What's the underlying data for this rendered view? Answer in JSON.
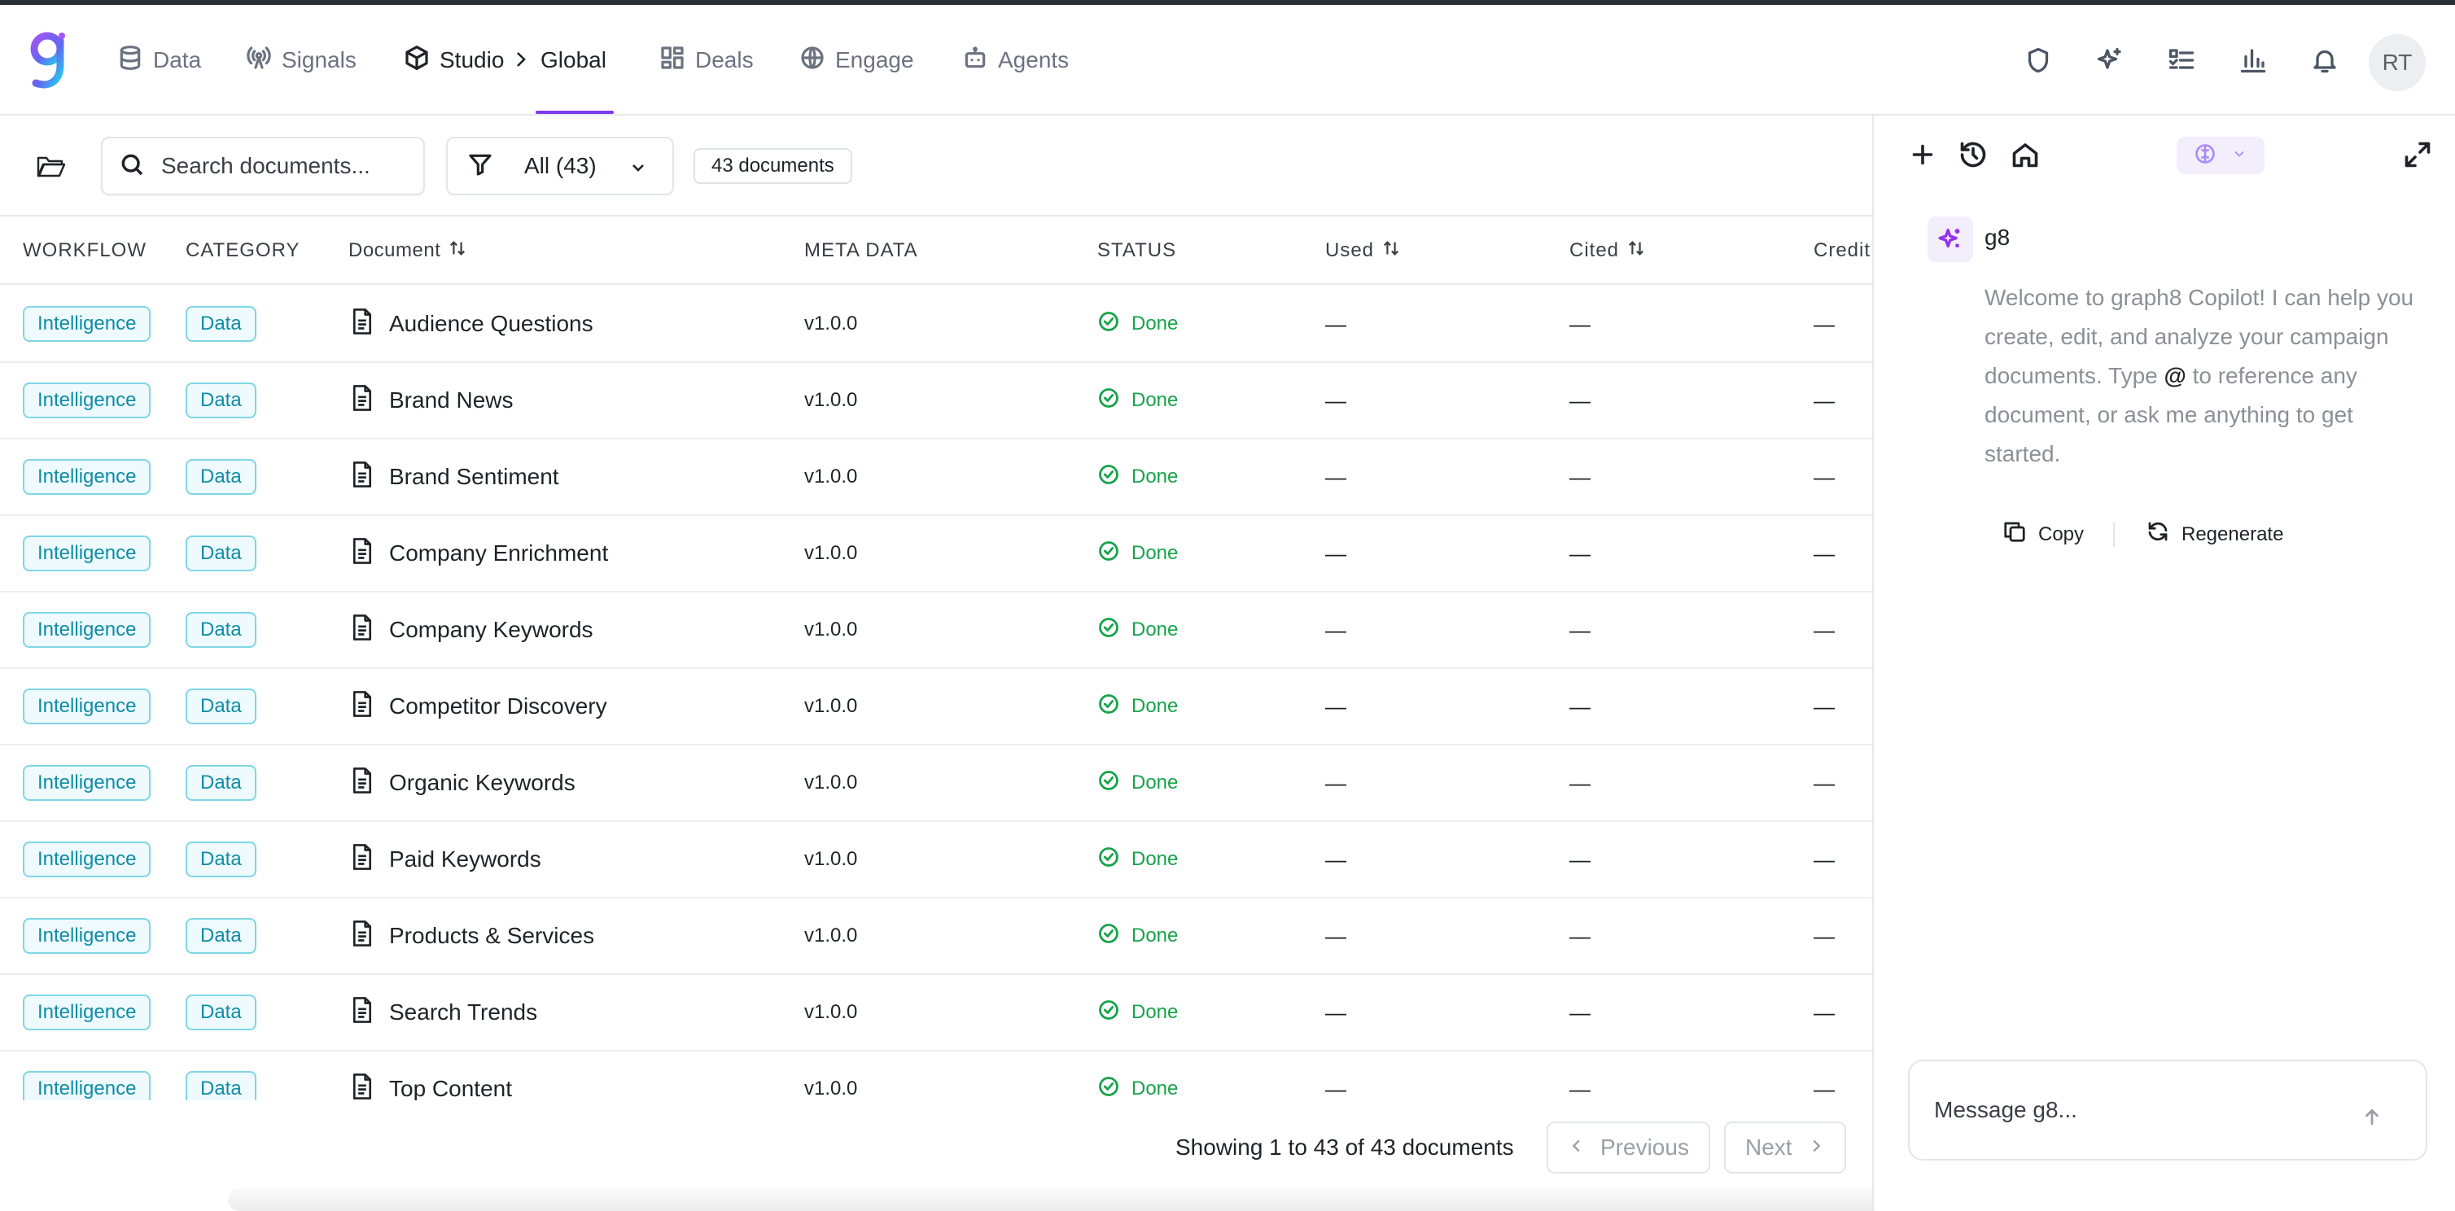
{
  "nav": {
    "items": [
      {
        "label": "Data",
        "icon": "database-icon"
      },
      {
        "label": "Signals",
        "icon": "broadcast-icon"
      },
      {
        "label": "Studio",
        "icon": "cube-icon"
      },
      {
        "label": "Global",
        "icon": ""
      },
      {
        "label": "Deals",
        "icon": "grid-icon"
      },
      {
        "label": "Engage",
        "icon": "globe-icon"
      },
      {
        "label": "Agents",
        "icon": "bot-icon"
      }
    ],
    "active": "Global",
    "avatar_initials": "RT",
    "tool_icons": [
      "shield-icon",
      "sparkles-icon",
      "checklist-icon",
      "bar-chart-icon",
      "bell-icon"
    ]
  },
  "toolbar": {
    "search_placeholder": "Search documents...",
    "filter_label": "All (43)",
    "count_label": "43 documents"
  },
  "table": {
    "headers": [
      "WORKFLOW",
      "CATEGORY",
      "Document",
      "META DATA",
      "STATUS",
      "Used",
      "Cited",
      "Credit"
    ],
    "rows": [
      {
        "workflow": "Intelligence",
        "category": "Data",
        "document": "Audience Questions",
        "meta": "v1.0.0",
        "status": "Done",
        "used": "—",
        "cited": "—",
        "credit": "—"
      },
      {
        "workflow": "Intelligence",
        "category": "Data",
        "document": "Brand News",
        "meta": "v1.0.0",
        "status": "Done",
        "used": "—",
        "cited": "—",
        "credit": "—"
      },
      {
        "workflow": "Intelligence",
        "category": "Data",
        "document": "Brand Sentiment",
        "meta": "v1.0.0",
        "status": "Done",
        "used": "—",
        "cited": "—",
        "credit": "—"
      },
      {
        "workflow": "Intelligence",
        "category": "Data",
        "document": "Company Enrichment",
        "meta": "v1.0.0",
        "status": "Done",
        "used": "—",
        "cited": "—",
        "credit": "—"
      },
      {
        "workflow": "Intelligence",
        "category": "Data",
        "document": "Company Keywords",
        "meta": "v1.0.0",
        "status": "Done",
        "used": "—",
        "cited": "—",
        "credit": "—"
      },
      {
        "workflow": "Intelligence",
        "category": "Data",
        "document": "Competitor Discovery",
        "meta": "v1.0.0",
        "status": "Done",
        "used": "—",
        "cited": "—",
        "credit": "—"
      },
      {
        "workflow": "Intelligence",
        "category": "Data",
        "document": "Organic Keywords",
        "meta": "v1.0.0",
        "status": "Done",
        "used": "—",
        "cited": "—",
        "credit": "—"
      },
      {
        "workflow": "Intelligence",
        "category": "Data",
        "document": "Paid Keywords",
        "meta": "v1.0.0",
        "status": "Done",
        "used": "—",
        "cited": "—",
        "credit": "—"
      },
      {
        "workflow": "Intelligence",
        "category": "Data",
        "document": "Products & Services",
        "meta": "v1.0.0",
        "status": "Done",
        "used": "—",
        "cited": "—",
        "credit": "—"
      },
      {
        "workflow": "Intelligence",
        "category": "Data",
        "document": "Search Trends",
        "meta": "v1.0.0",
        "status": "Done",
        "used": "—",
        "cited": "—",
        "credit": "—"
      },
      {
        "workflow": "Intelligence",
        "category": "Data",
        "document": "Top Content",
        "meta": "v1.0.0",
        "status": "Done",
        "used": "—",
        "cited": "—",
        "credit": "—"
      }
    ]
  },
  "footer": {
    "showing": "Showing 1 to 43 of 43 documents",
    "previous": "Previous",
    "next": "Next"
  },
  "copilot": {
    "assistant_name": "g8",
    "welcome_before": "Welcome to graph8 Copilot! I can help you create, edit, and analyze your campaign documents. Type ",
    "welcome_at": "@",
    "welcome_after": " to reference any document, or ask me anything to get started.",
    "copy_label": "Copy",
    "regenerate_label": "Regenerate",
    "message_placeholder": "Message g8..."
  },
  "colors": {
    "accent": "#7c3aed",
    "pill_border": "#7fd6e6",
    "pill_text": "#0e8ca6",
    "status_done": "#16a34a"
  }
}
